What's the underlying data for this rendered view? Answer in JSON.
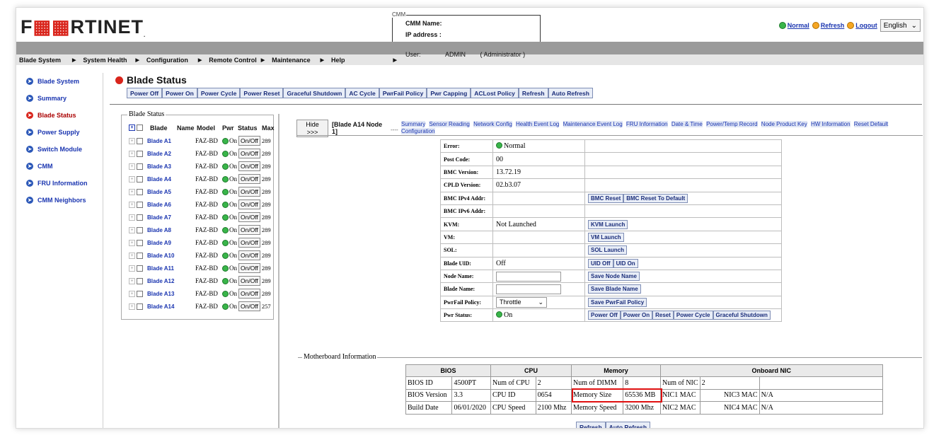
{
  "header": {
    "logo": "FORTINET",
    "cmm_legend": "CMM",
    "cmm_name_label": "CMM Name:",
    "ip_label": "IP address :",
    "links": {
      "normal": "Normal",
      "refresh": "Refresh",
      "logout": "Logout"
    },
    "language": "English"
  },
  "nav": {
    "items": [
      "Blade System",
      "System Health",
      "Configuration",
      "Remote Control",
      "Maintenance",
      "Help"
    ],
    "user_label": "User:",
    "user": "ADMIN",
    "role": "( Administrator )"
  },
  "sidebar": {
    "items": [
      "Blade System",
      "Summary",
      "Blade Status",
      "Power Supply",
      "Switch Module",
      "CMM",
      "FRU Information",
      "CMM Neighbors"
    ],
    "active_index": 2
  },
  "page": {
    "title": "Blade Status",
    "actions": [
      "Power Off",
      "Power On",
      "Power Cycle",
      "Power Reset",
      "Graceful Shutdown",
      "AC Cycle",
      "PwrFail Policy",
      "Pwr Capping",
      "ACLost Policy",
      "Refresh",
      "Auto Refresh"
    ]
  },
  "blade_list": {
    "legend": "Blade Status",
    "headers": [
      "Blade",
      "Name",
      "Model",
      "Pwr",
      "Status",
      "Max"
    ],
    "rows": [
      {
        "blade": "Blade A1",
        "model": "FAZ-BD",
        "pwr": "On",
        "status": "On/Off",
        "max": "289"
      },
      {
        "blade": "Blade A2",
        "model": "FAZ-BD",
        "pwr": "On",
        "status": "On/Off",
        "max": "289"
      },
      {
        "blade": "Blade A3",
        "model": "FAZ-BD",
        "pwr": "On",
        "status": "On/Off",
        "max": "289"
      },
      {
        "blade": "Blade A4",
        "model": "FAZ-BD",
        "pwr": "On",
        "status": "On/Off",
        "max": "289"
      },
      {
        "blade": "Blade A5",
        "model": "FAZ-BD",
        "pwr": "On",
        "status": "On/Off",
        "max": "289"
      },
      {
        "blade": "Blade A6",
        "model": "FAZ-BD",
        "pwr": "On",
        "status": "On/Off",
        "max": "289"
      },
      {
        "blade": "Blade A7",
        "model": "FAZ-BD",
        "pwr": "On",
        "status": "On/Off",
        "max": "289"
      },
      {
        "blade": "Blade A8",
        "model": "FAZ-BD",
        "pwr": "On",
        "status": "On/Off",
        "max": "289"
      },
      {
        "blade": "Blade A9",
        "model": "FAZ-BD",
        "pwr": "On",
        "status": "On/Off",
        "max": "289"
      },
      {
        "blade": "Blade A10",
        "model": "FAZ-BD",
        "pwr": "On",
        "status": "On/Off",
        "max": "289"
      },
      {
        "blade": "Blade A11",
        "model": "FAZ-BD",
        "pwr": "On",
        "status": "On/Off",
        "max": "289"
      },
      {
        "blade": "Blade A12",
        "model": "FAZ-BD",
        "pwr": "On",
        "status": "On/Off",
        "max": "289"
      },
      {
        "blade": "Blade A13",
        "model": "FAZ-BD",
        "pwr": "On",
        "status": "On/Off",
        "max": "289"
      },
      {
        "blade": "Blade A14",
        "model": "FAZ-BD",
        "pwr": "On",
        "status": "On/Off",
        "max": "257"
      }
    ]
  },
  "node_panel": {
    "hide_label": "Hide",
    "hide_arrows": ">>>",
    "node_title": "[Blade A14 Node 1]",
    "tabs": [
      "Summary",
      "Sensor Reading",
      "Network Config",
      "Health Event Log",
      "Maintenance Event Log",
      "FRU Information",
      "Date & Time",
      "Power/Temp Record",
      "Node Product Key",
      "HW Information",
      "Reset Default Configuration"
    ],
    "details": {
      "error": {
        "label": "Error:",
        "value": "Normal"
      },
      "post_code": {
        "label": "Post Code:",
        "value": "00"
      },
      "bmc_version": {
        "label": "BMC Version:",
        "value": "13.72.19"
      },
      "cpld_version": {
        "label": "CPLD Version:",
        "value": "02.b3.07"
      },
      "bmc_ipv4": {
        "label": "BMC IPv4 Addr:",
        "value": "",
        "buttons": [
          "BMC Reset",
          "BMC Reset To Default"
        ]
      },
      "bmc_ipv6": {
        "label": "BMC IPv6 Addr:",
        "value": ""
      },
      "kvm": {
        "label": "KVM:",
        "value": "Not Launched",
        "button": "KVM Launch"
      },
      "vm": {
        "label": "VM:",
        "value": "",
        "button": "VM Launch"
      },
      "sol": {
        "label": "SOL:",
        "value": "",
        "button": "SOL Launch"
      },
      "blade_uid": {
        "label": "Blade UID:",
        "value": "Off",
        "buttons": [
          "UID Off",
          "UID On"
        ]
      },
      "node_name": {
        "label": "Node Name:",
        "button": "Save Node Name"
      },
      "blade_name": {
        "label": "Blade Name:",
        "button": "Save Blade Name"
      },
      "pwrfail": {
        "label": "PwrFail Policy:",
        "value": "Throttle",
        "button": "Save PwrFail Policy"
      },
      "pwr_status": {
        "label": "Pwr Status:",
        "value": "On",
        "buttons": [
          "Power Off",
          "Power On",
          "Reset",
          "Power Cycle",
          "Graceful Shutdown"
        ]
      }
    }
  },
  "motherboard": {
    "legend": "Motherboard Information",
    "headers": {
      "bios": "BIOS",
      "cpu": "CPU",
      "memory": "Memory",
      "nic": "Onboard NIC"
    },
    "bios_id": {
      "label": "BIOS ID",
      "value": "4500PT"
    },
    "bios_version": {
      "label": "BIOS Version",
      "value": "3.3"
    },
    "build_date": {
      "label": "Build Date",
      "value": "06/01/2020"
    },
    "num_cpu": {
      "label": "Num of CPU",
      "value": "2"
    },
    "cpu_id": {
      "label": "CPU ID",
      "value": "0654"
    },
    "cpu_speed": {
      "label": "CPU Speed",
      "value": "2100 Mhz"
    },
    "num_dimm": {
      "label": "Num of DIMM",
      "value": "8"
    },
    "mem_size": {
      "label": "Memory Size",
      "value": "65536 MB"
    },
    "mem_speed": {
      "label": "Memory Speed",
      "value": "3200 Mhz"
    },
    "num_nic": {
      "label": "Num of NIC",
      "value": "2"
    },
    "nic1": {
      "label": "NIC1 MAC",
      "value": ""
    },
    "nic2": {
      "label": "NIC2 MAC",
      "value": ""
    },
    "nic3": {
      "label": "NIC3 MAC",
      "value": "N/A"
    },
    "nic4": {
      "label": "NIC4 MAC",
      "value": "N/A"
    }
  },
  "bottom_buttons": [
    "Refresh",
    "Auto Refresh"
  ]
}
